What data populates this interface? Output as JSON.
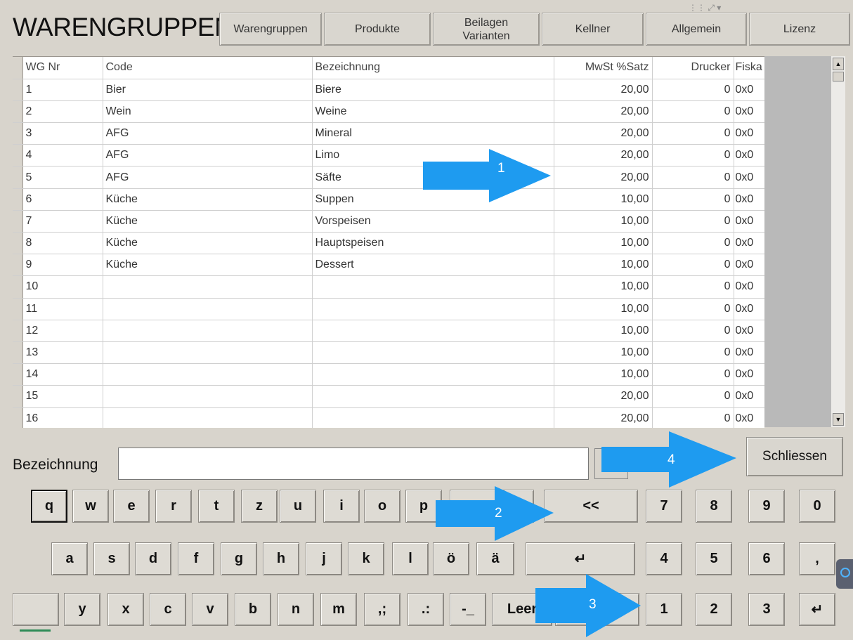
{
  "header": {
    "title": "WARENGRUPPEN",
    "tabs": [
      {
        "line1": "Warengruppen",
        "line2": ""
      },
      {
        "line1": "Produkte",
        "line2": ""
      },
      {
        "line1": "Beilagen",
        "line2": "Varianten"
      },
      {
        "line1": "Kellner",
        "line2": ""
      },
      {
        "line1": "Allgemein",
        "line2": ""
      },
      {
        "line1": "Lizenz",
        "line2": ""
      }
    ]
  },
  "table": {
    "columns": [
      "WG Nr",
      "Code",
      "Bezeichnung",
      "MwSt %Satz",
      "Drucker",
      "Fiska"
    ],
    "rows": [
      [
        "1",
        "Bier",
        "Biere",
        "20,00",
        "0",
        "0x0"
      ],
      [
        "2",
        "Wein",
        "Weine",
        "20,00",
        "0",
        "0x0"
      ],
      [
        "3",
        "AFG",
        "Mineral",
        "20,00",
        "0",
        "0x0"
      ],
      [
        "4",
        "AFG",
        "Limo",
        "20,00",
        "0",
        "0x0"
      ],
      [
        "5",
        "AFG",
        "Säfte",
        "20,00",
        "0",
        "0x0"
      ],
      [
        "6",
        "Küche",
        "Suppen",
        "10,00",
        "0",
        "0x0"
      ],
      [
        "7",
        "Küche",
        "Vorspeisen",
        "10,00",
        "0",
        "0x0"
      ],
      [
        "8",
        "Küche",
        "Hauptspeisen",
        "10,00",
        "0",
        "0x0"
      ],
      [
        "9",
        "Küche",
        "Dessert",
        "10,00",
        "0",
        "0x0"
      ],
      [
        "10",
        "",
        "",
        "10,00",
        "0",
        "0x0"
      ],
      [
        "11",
        "",
        "",
        "10,00",
        "0",
        "0x0"
      ],
      [
        "12",
        "",
        "",
        "10,00",
        "0",
        "0x0"
      ],
      [
        "13",
        "",
        "",
        "10,00",
        "0",
        "0x0"
      ],
      [
        "14",
        "",
        "",
        "10,00",
        "0",
        "0x0"
      ],
      [
        "15",
        "",
        "",
        "20,00",
        "0",
        "0x0"
      ],
      [
        "16",
        "",
        "",
        "20,00",
        "0",
        "0x0"
      ]
    ]
  },
  "form": {
    "label": "Bezeichnung",
    "value": "",
    "close_label": "Schliessen"
  },
  "keyboard": {
    "row1": [
      "q",
      "w",
      "e",
      "r",
      "t",
      "z",
      "u",
      "i",
      "o",
      "p",
      "",
      "<<",
      "7",
      "8",
      "9",
      "0"
    ],
    "row2": [
      "a",
      "s",
      "d",
      "f",
      "g",
      "h",
      "j",
      "k",
      "l",
      "ö",
      "ä",
      "↵",
      "4",
      "5",
      "6",
      ","
    ],
    "row3": [
      "",
      "y",
      "x",
      "c",
      "v",
      "b",
      "n",
      "m",
      ",;",
      ".:",
      "-_",
      "Leer",
      "",
      "1",
      "2",
      "3",
      "↵"
    ]
  },
  "annotations": [
    "1",
    "2",
    "3",
    "4"
  ],
  "colors": {
    "arrow": "#1e9bf0",
    "background": "#d8d4cc"
  }
}
